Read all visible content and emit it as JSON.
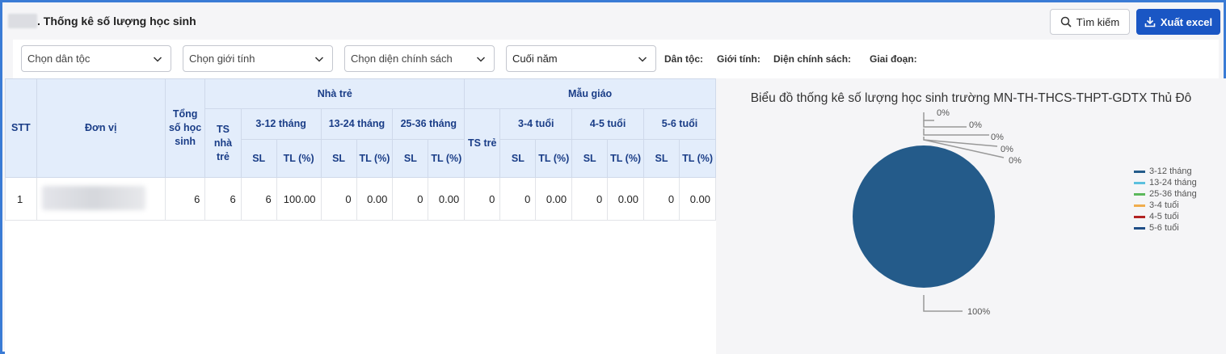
{
  "header": {
    "title": ". Thống kê số lượng học sinh",
    "search_label": "Tìm kiếm",
    "export_label": "Xuất excel"
  },
  "filters": {
    "ethnicity_placeholder": "Chọn dân tộc",
    "gender_placeholder": "Chọn giới tính",
    "policy_placeholder": "Chọn diện chính sách",
    "period_value": "Cuối năm",
    "ethnicity_label": "Dân tộc:",
    "gender_label": "Giới tính:",
    "policy_label": "Diện chính sách:",
    "period_label": "Giai đoạn:"
  },
  "table": {
    "headers": {
      "stt": "STT",
      "unit": "Đơn vị",
      "total": "Tổng số học sinh",
      "nursery": "Nhà trẻ",
      "kindergarten": "Mẫu giáo",
      "ts_nursery": "TS nhà trẻ",
      "ts_kids": "TS trẻ",
      "g_3_12": "3-12 tháng",
      "g_13_24": "13-24 tháng",
      "g_25_36": "25-36 tháng",
      "g_3_4": "3-4 tuổi",
      "g_4_5": "4-5 tuổi",
      "g_5_6": "5-6 tuổi",
      "sl": "SL",
      "tl": "TL (%)"
    },
    "rows": [
      {
        "stt": "1",
        "total": "6",
        "ts_nursery": "6",
        "sl_3_12": "6",
        "tl_3_12": "100.00",
        "sl_13_24": "0",
        "tl_13_24": "0.00",
        "sl_25_36": "0",
        "tl_25_36": "0.00",
        "ts_kids": "0",
        "sl_3_4": "0",
        "tl_3_4": "0.00",
        "sl_4_5": "0",
        "tl_4_5": "0.00",
        "sl_5_6": "0",
        "tl_5_6": "0.00"
      }
    ]
  },
  "chart_data": {
    "type": "pie",
    "title": "Biểu đồ thống kê số lượng học sinh trường MN-TH-THCS-THPT-GDTX Thủ Đô",
    "categories": [
      "3-12 tháng",
      "13-24 tháng",
      "25-36 tháng",
      "3-4 tuổi",
      "4-5 tuổi",
      "5-6 tuổi"
    ],
    "values": [
      100,
      0,
      0,
      0,
      0,
      0
    ],
    "labels": [
      "100%",
      "0%",
      "0%",
      "0%",
      "0%",
      "0%"
    ],
    "colors": [
      "#245b8a",
      "#5bc0de",
      "#5cb85c",
      "#f0ad4e",
      "#b22222",
      "#1f4e86"
    ],
    "legend": "right"
  }
}
